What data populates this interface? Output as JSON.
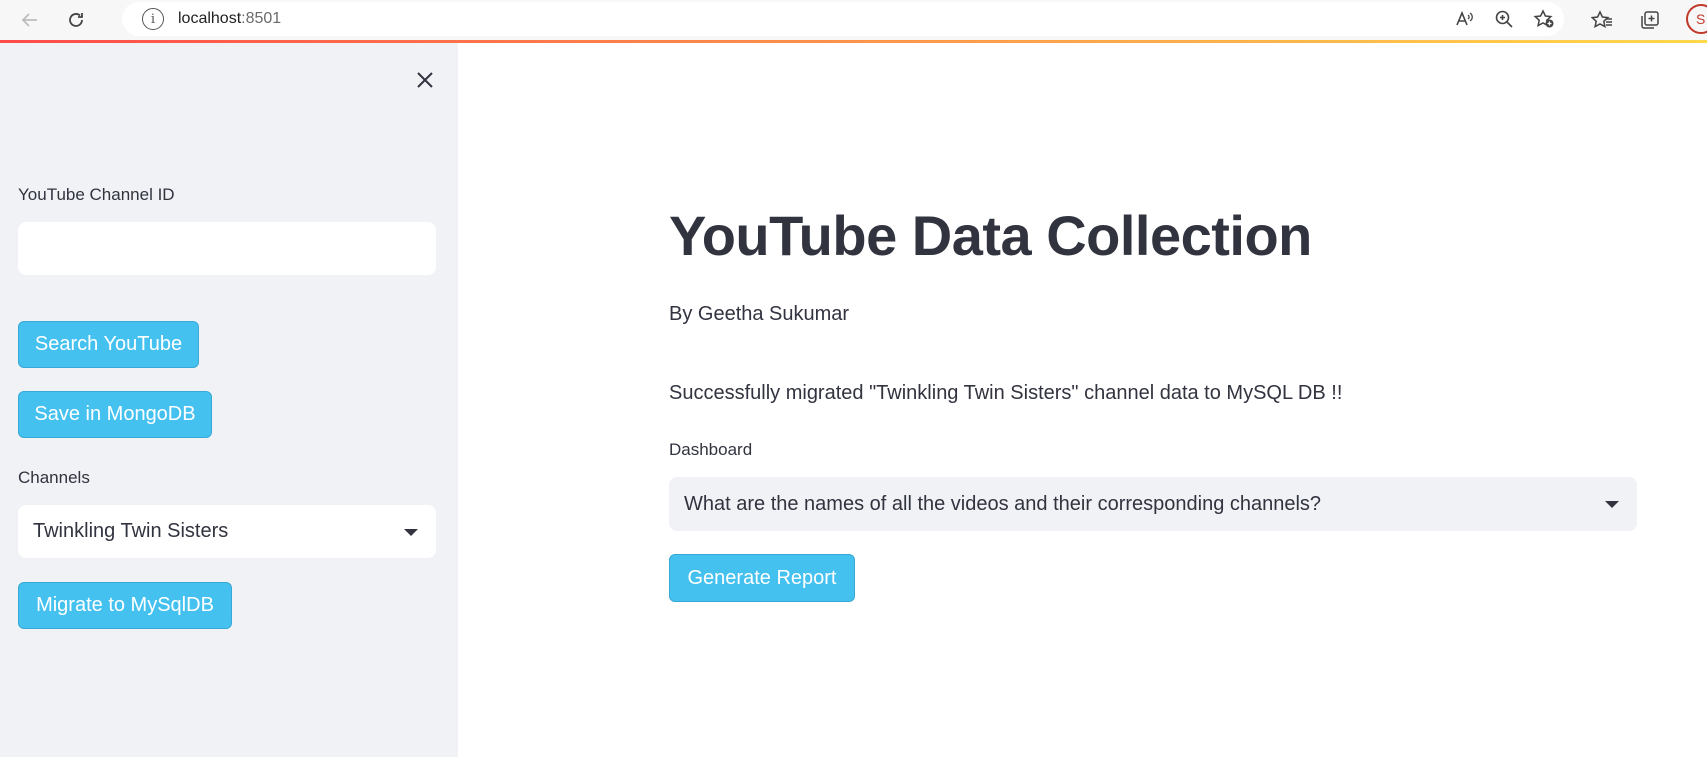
{
  "browser": {
    "url_host": "localhost",
    "url_port": ":8501",
    "profile_initial": "S"
  },
  "sidebar": {
    "channel_id_label": "YouTube Channel ID",
    "channel_id_value": "",
    "search_button": "Search YouTube",
    "save_button": "Save in MongoDB",
    "channels_label": "Channels",
    "channels_selected": "Twinkling Twin Sisters",
    "migrate_button": "Migrate to MySqlDB"
  },
  "main": {
    "title": "YouTube Data Collection",
    "author": "By Geetha Sukumar",
    "status_message": "Successfully migrated \"Twinkling Twin Sisters\" channel data to MySQL DB !!",
    "dashboard_label": "Dashboard",
    "dashboard_selected": "What are the names of all the videos and their corresponding channels?",
    "generate_button": "Generate Report"
  },
  "colors": {
    "button_bg": "#45c1f0",
    "sidebar_bg": "#f0f2f6",
    "text": "#31333f",
    "top_gradient_start": "#ff4b4b"
  }
}
